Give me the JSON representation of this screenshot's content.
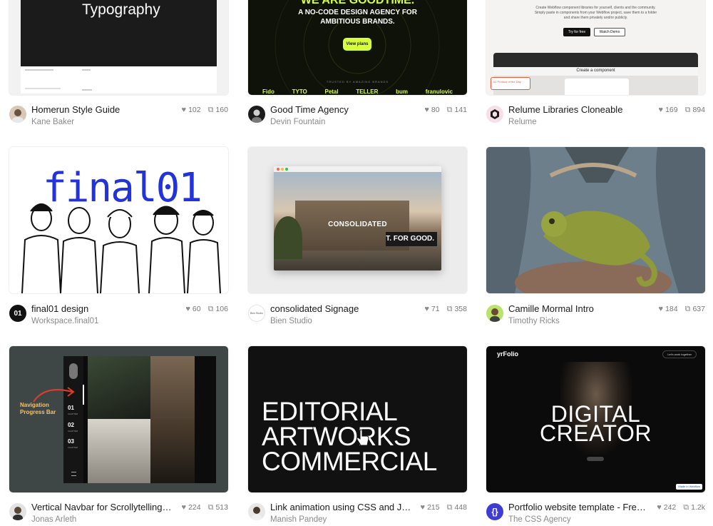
{
  "cards": [
    {
      "title": "Homerun Style Guide",
      "author": "Kane Baker",
      "likes": "102",
      "clones": "160",
      "thumb_text": "Typography"
    },
    {
      "title": "Good Time Agency",
      "author": "Devin Fountain",
      "likes": "80",
      "clones": "141",
      "thumb_headline": "WE ARE GOODTIME.",
      "thumb_sub": "A NO-CODE DESIGN AGENCY FOR AMBITIOUS BRANDS.",
      "thumb_button": "View plans",
      "thumb_trusted": "TRUSTED BY AMAZING BRANDS",
      "thumb_logos": [
        "Fido",
        "TYTO",
        "Petal",
        "TELLER",
        "bum",
        "franulovic"
      ]
    },
    {
      "title": "Relume Libraries Cloneable",
      "author": "Relume",
      "likes": "169",
      "clones": "894",
      "thumb_lines": [
        "Create Webflow component libraries for yourself, clients and the community.",
        "Simply paste in components from your Webflow project, save them to a folder",
        "and share them privately and/or publicly."
      ],
      "thumb_btn1": "Try for free",
      "thumb_btn2": "Watch Demo",
      "thumb_app_title": "Create a component",
      "thumb_badge": "#1 Product of the Day"
    },
    {
      "title": "final01 design",
      "author": "Workspace.final01",
      "likes": "60",
      "clones": "106",
      "thumb_text": "final01"
    },
    {
      "title": "consolidated Signage",
      "author": "Bien Studio",
      "likes": "71",
      "clones": "358",
      "thumb_text": "CONSOLIDATED",
      "thumb_text2": "T. FOR GOOD.",
      "avatar_text": "Bien Studio"
    },
    {
      "title": "Camille Mormal Intro",
      "author": "Timothy Ricks",
      "likes": "184",
      "clones": "637"
    },
    {
      "title": "Vertical Navbar for Scrollytelling …",
      "author": "Jonas Arleth",
      "likes": "224",
      "clones": "513",
      "thumb_label": "Navigation Progress Bar",
      "thumb_nums": [
        "01",
        "02",
        "03"
      ],
      "thumb_sublabel": "CHAPTER"
    },
    {
      "title": "Link animation using CSS and Ja…",
      "author": "Manish Pandey",
      "likes": "215",
      "clones": "448",
      "thumb_lines": [
        "EDITORIAL",
        "ARTWORKS",
        "COMMERCIAL"
      ]
    },
    {
      "title": "Portfolio website template - Free…",
      "author": "The CSS Agency",
      "likes": "242",
      "clones": "1.2k",
      "thumb_logo": "yrFolio",
      "thumb_btn": "Let's work together",
      "thumb_lines": [
        "DIGITAL",
        "CREATOR"
      ],
      "thumb_badge": "Made in Webflow"
    }
  ],
  "icons": {
    "like": "heart-icon",
    "clone": "clone-icon"
  },
  "colors": {
    "title": "#1a1a1a",
    "meta": "#8a8a8a",
    "accent_green": "#d7ff3b"
  }
}
